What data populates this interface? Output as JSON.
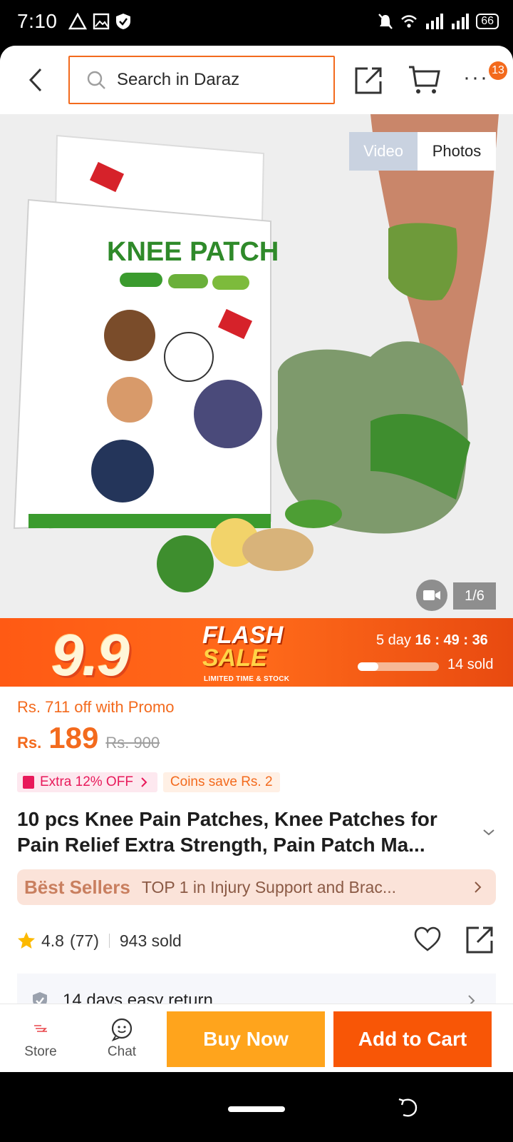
{
  "status_bar": {
    "time": "7:10",
    "battery": "66"
  },
  "header": {
    "search_placeholder": "Search in Daraz",
    "more_label": "···",
    "cart_badge": "13"
  },
  "gallery": {
    "toggle_video": "Video",
    "toggle_photos": "Photos",
    "counter": "1/6"
  },
  "flash_sale": {
    "big_number": "9.9",
    "title_line1": "FLASH",
    "title_line2": "SALE",
    "subtitle": "LIMITED TIME & STOCK",
    "countdown_days": "5 day",
    "countdown_h": "16",
    "countdown_m": "49",
    "countdown_s": "36",
    "sold_text": "14 sold",
    "sold_progress": 0.25
  },
  "price": {
    "promo": "Rs. 711 off with Promo",
    "currency": "Rs.",
    "value": "189",
    "old": "Rs. 900",
    "chip_extra": "Extra 12% OFF",
    "chip_coins": "Coins save Rs. 2"
  },
  "product": {
    "title": "10 pcs Knee Pain Patches, Knee Patches for Pain Relief Extra Strength, Pain Patch Ma..."
  },
  "best_sellers": {
    "logo": "Bëst Sellers",
    "text": "TOP 1 in Injury Support and Brac..."
  },
  "rating": {
    "score": "4.8",
    "count": "(77)",
    "sold": "943 sold"
  },
  "service": {
    "return_text": "14 days easy return"
  },
  "bottom": {
    "store_label": "Store",
    "chat_label": "Chat",
    "buy_now": "Buy Now",
    "add_to_cart": "Add to Cart"
  },
  "colors": {
    "accent": "#f36a1d",
    "buy_now": "#ffa41c",
    "add_to_cart": "#f85606"
  }
}
